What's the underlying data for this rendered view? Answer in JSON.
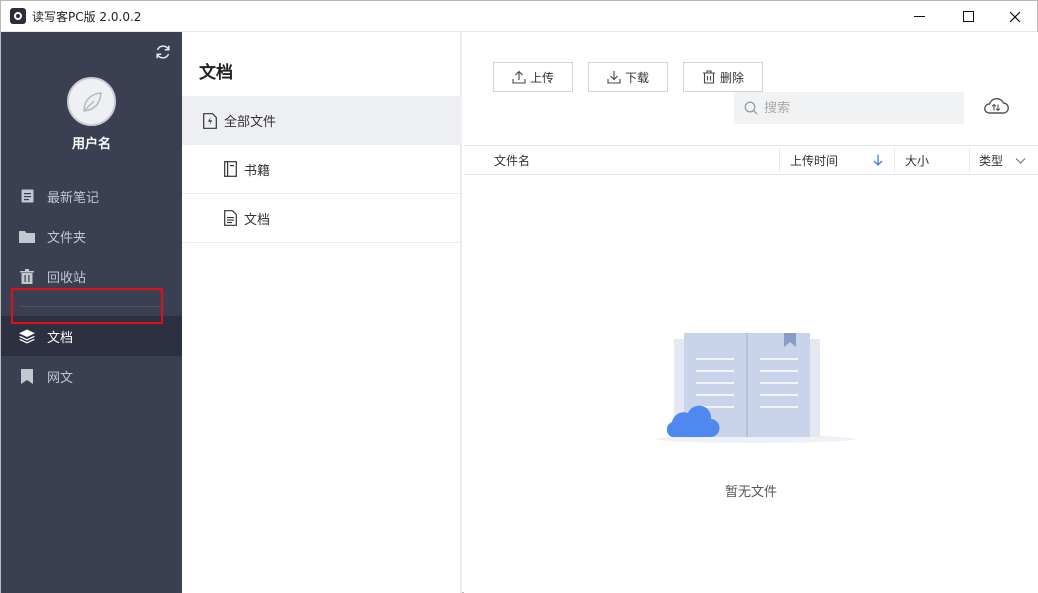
{
  "window": {
    "title": "读写客PC版 2.0.0.2"
  },
  "sidebar": {
    "username": "用户名",
    "items": [
      {
        "label": "最新笔记",
        "icon": "note-icon"
      },
      {
        "label": "文件夹",
        "icon": "folder-icon"
      },
      {
        "label": "回收站",
        "icon": "trash-icon"
      },
      {
        "label": "文档",
        "icon": "layers-icon",
        "active": true
      },
      {
        "label": "网文",
        "icon": "bookmark-icon"
      }
    ]
  },
  "middle": {
    "title": "文档",
    "categories": [
      {
        "label": "全部文件",
        "icon": "all-files-icon",
        "selected": true
      },
      {
        "label": "书籍",
        "icon": "book-icon"
      },
      {
        "label": "文档",
        "icon": "document-icon"
      }
    ]
  },
  "toolbar": {
    "upload_label": "上传",
    "download_label": "下载",
    "delete_label": "删除"
  },
  "search": {
    "placeholder": "搜索",
    "value": ""
  },
  "table": {
    "columns": [
      "文件名",
      "上传时间",
      "大小",
      "类型"
    ],
    "sort_column": "上传时间",
    "sort_direction": "descending",
    "rows": []
  },
  "empty_state": {
    "text": "暂无文件"
  },
  "colors": {
    "sidebar_bg": "#3a3f51",
    "sidebar_active_bg": "#2c3040",
    "highlight_border": "#e0101a",
    "sort_arrow": "#3f7fd6"
  }
}
